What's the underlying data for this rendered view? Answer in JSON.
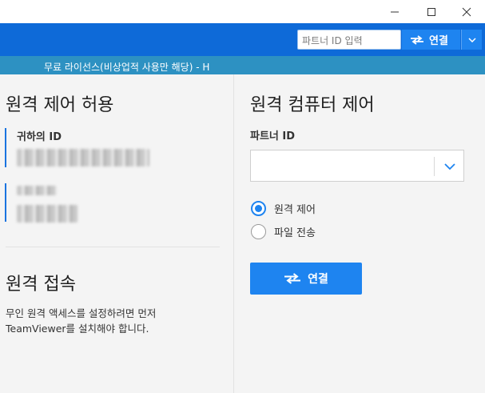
{
  "titlebar": {
    "minimize_icon": "minimize-icon",
    "maximize_icon": "maximize-icon",
    "close_icon": "close-icon"
  },
  "topbar": {
    "partner_id_placeholder": "파트너 ID 입력",
    "connect_label": "연결",
    "connect_icon": "swap-arrows-icon",
    "dropdown_icon": "chevron-down-icon"
  },
  "license_text": "무료 라이선스(비상업적 사용만 해당) - H",
  "left": {
    "allow_title": "원격 제어 허용",
    "your_id_label": "귀하의 ID",
    "your_id_value_hidden": true,
    "password_value_hidden": true,
    "unattended_title": "원격 접속",
    "unattended_text_line1": "무인 원격 액세스를 설정하려면 먼저",
    "unattended_text_line2": "TeamViewer를 설치해야 합니다."
  },
  "right": {
    "control_title": "원격 컴퓨터 제어",
    "partner_id_label": "파트너 ID",
    "partner_id_value": "",
    "options": [
      {
        "label": "원격 제어",
        "selected": true
      },
      {
        "label": "파일 전송",
        "selected": false
      }
    ],
    "connect_label": "연결"
  },
  "colors": {
    "brand_blue": "#0e6ad8",
    "button_blue": "#1e84f0",
    "license_bar": "#2d91c2"
  }
}
